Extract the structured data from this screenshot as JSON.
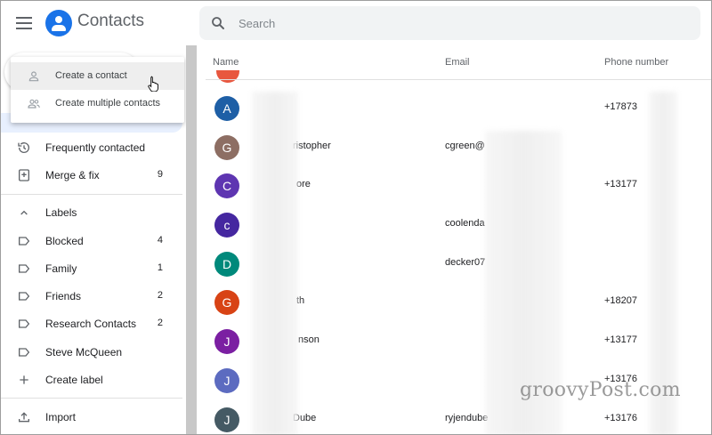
{
  "app": {
    "title": "Contacts"
  },
  "search": {
    "placeholder": "Search"
  },
  "popup": {
    "items": [
      {
        "label": "Create a contact"
      },
      {
        "label": "Create multiple contacts"
      }
    ]
  },
  "sidebar": {
    "items": [
      {
        "label": "Frequently contacted",
        "count": ""
      },
      {
        "label": "Merge & fix",
        "count": "9"
      }
    ],
    "labels_header": "Labels",
    "labels": [
      {
        "label": "Blocked",
        "count": "4"
      },
      {
        "label": "Family",
        "count": "1"
      },
      {
        "label": "Friends",
        "count": "2"
      },
      {
        "label": "Research Contacts",
        "count": "2"
      },
      {
        "label": "Steve McQueen",
        "count": ""
      }
    ],
    "create_label": "Create label",
    "import": "Import"
  },
  "table": {
    "columns": {
      "name": "Name",
      "email": "Email",
      "phone": "Phone number"
    },
    "rows": [
      {
        "initial": "A",
        "color": "#1e5fa6",
        "name": "",
        "email": "",
        "phone": "+17873"
      },
      {
        "initial": "G",
        "color": "#8d6e63",
        "name": "ristopher",
        "email": "cgreen@",
        "phone": ""
      },
      {
        "initial": "C",
        "color": "#5e35b1",
        "name": "ore",
        "email": "",
        "phone": "+13177"
      },
      {
        "initial": "c",
        "color": "#4527a0",
        "name": "",
        "email": "coolenda",
        "phone": ""
      },
      {
        "initial": "D",
        "color": "#00897b",
        "name": "",
        "email": "decker07",
        "phone": ""
      },
      {
        "initial": "G",
        "color": "#d84315",
        "name": "th",
        "email": "",
        "phone": "+18207"
      },
      {
        "initial": "J",
        "color": "#7b1fa2",
        "name": "nson",
        "email": "",
        "phone": "+13177"
      },
      {
        "initial": "J",
        "color": "#5c6bc0",
        "name": "",
        "email": "",
        "phone": "+13176"
      },
      {
        "initial": "J",
        "color": "#455a64",
        "name": "Dube",
        "email": "ryjendube",
        "phone": "+13176"
      }
    ]
  },
  "watermark": "groovyPost.com"
}
